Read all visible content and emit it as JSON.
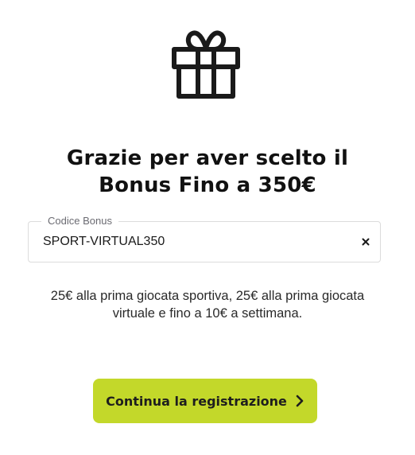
{
  "icons": {
    "header": "gift-icon",
    "clear": "close-icon",
    "cta": "chevron-right-icon"
  },
  "title": {
    "line1": "Grazie per aver scelto il",
    "line2": "Bonus Fino a 350€"
  },
  "bonus_field": {
    "label": "Codice Bonus",
    "value": "SPORT-VIRTUAL350"
  },
  "description": {
    "line1": "25€ alla prima giocata sportiva, 25€ alla prima giocata",
    "line2": "virtuale e fino a 10€ a settimana."
  },
  "cta": {
    "label": "Continua la registrazione"
  },
  "colors": {
    "accent": "#c3d82a",
    "text": "#111111",
    "field_border": "#dcdcdc",
    "label": "#6b6b72"
  }
}
